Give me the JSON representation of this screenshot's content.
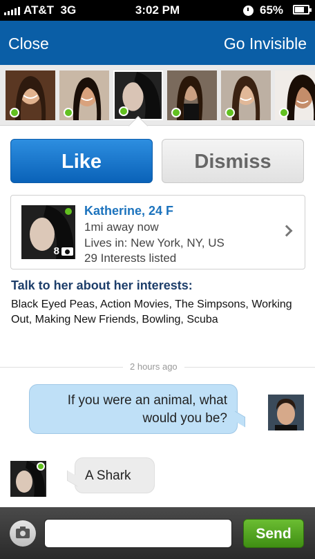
{
  "status_bar": {
    "carrier": "AT&T",
    "network": "3G",
    "time": "3:02 PM",
    "battery": "65%"
  },
  "navbar": {
    "close_label": "Close",
    "invisible_label": "Go Invisible"
  },
  "thumbnails": [
    {
      "name": "photo-1",
      "online": true
    },
    {
      "name": "photo-2",
      "online": true
    },
    {
      "name": "photo-3",
      "online": true
    },
    {
      "name": "photo-4",
      "online": true
    },
    {
      "name": "photo-5",
      "online": true
    },
    {
      "name": "photo-6",
      "online": true
    }
  ],
  "actions": {
    "like_label": "Like",
    "dismiss_label": "Dismiss"
  },
  "profile": {
    "name_age": "Katherine, 24 F",
    "distance": "1mi away now",
    "location": "Lives in: New York, NY, US",
    "interests_count": "29 Interests listed",
    "photo_count": "8"
  },
  "interests": {
    "title": "Talk to her about her interests:",
    "text": "Black Eyed Peas, Action Movies, The Simpsons, Working Out, Making New Friends, Bowling, Scuba"
  },
  "chat": {
    "timestamp": "2 hours ago",
    "outgoing_message": "If you were an animal, what would you be?",
    "incoming_message": "A Shark"
  },
  "composer": {
    "placeholder": "",
    "send_label": "Send"
  },
  "colors": {
    "nav_blue": "#0a5ea6",
    "like_blue": "#1c73bd",
    "online_green": "#62c020",
    "send_green": "#4f9f1f"
  },
  "icons": {
    "camera": "camera-icon",
    "chevron": "chevron-right-icon",
    "clock": "clock-icon",
    "battery": "battery-icon"
  }
}
